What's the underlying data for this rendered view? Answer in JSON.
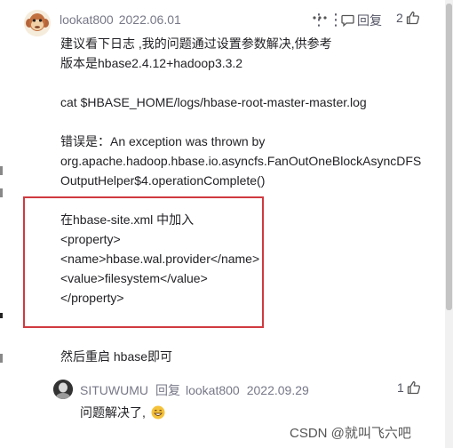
{
  "comment": {
    "author": "lookat800",
    "date": "2022.06.01",
    "reply_label": "回复",
    "like_count": "2",
    "lines": [
      "建议看下日志 ,我的问题通过设置参数解决,供参考",
      "版本是hbase2.4.12+hadoop3.3.2",
      "",
      "cat $HBASE_HOME/logs/hbase-root-master-master.log",
      "",
      "错误是：An exception was thrown by",
      "org.apache.hadoop.hbase.io.asyncfs.FanOutOneBlockAsyncDFS",
      "OutputHelper$4.operationComplete()",
      "",
      "在hbase-site.xml 中加入",
      "<property>",
      "<name>hbase.wal.provider</name>",
      "<value>filesystem</value>",
      "</property>",
      "",
      "",
      "然后重启 hbase即可"
    ]
  },
  "reply": {
    "author": "SITUWUMU",
    "reply_word": "回复",
    "target": "lookat800",
    "date": "2022.09.29",
    "text": "问题解决了,",
    "like_count": "1"
  },
  "watermark": "CSDN @就叫飞六吧"
}
